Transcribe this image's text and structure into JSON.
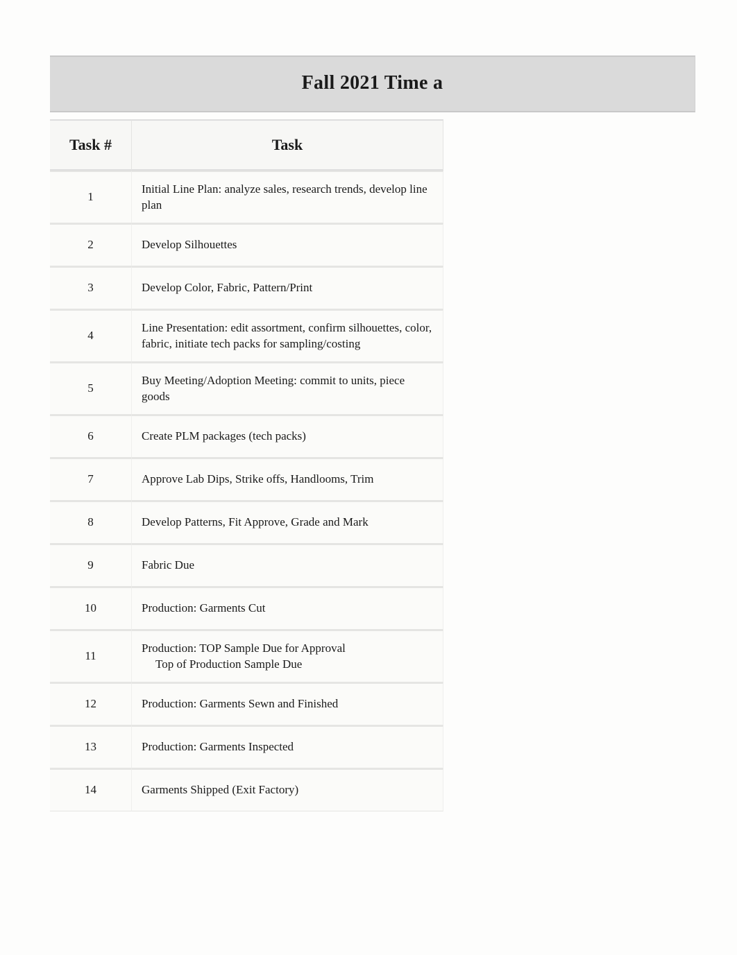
{
  "title": "Fall 2021 Time a",
  "headers": {
    "num": "Task #",
    "task": "Task"
  },
  "rows": [
    {
      "num": "1",
      "task": "Initial Line Plan: analyze sales, research trends, develop line plan",
      "lines": 2
    },
    {
      "num": "2",
      "task": "Develop Silhouettes",
      "lines": 1
    },
    {
      "num": "3",
      "task": "Develop Color, Fabric, Pattern/Print",
      "lines": 1
    },
    {
      "num": "4",
      "task": "Line Presentation: edit assortment, confirm silhouettes, color, fabric, initiate tech packs for sampling/costing",
      "lines": 2
    },
    {
      "num": "5",
      "task": "Buy Meeting/Adoption Meeting: commit to units, piece goods",
      "lines": 2
    },
    {
      "num": "6",
      "task": "Create PLM packages (tech packs)",
      "lines": 1
    },
    {
      "num": "7",
      "task": "Approve Lab Dips, Strike offs, Handlooms, Trim",
      "lines": 1
    },
    {
      "num": "8",
      "task": "Develop Patterns, Fit Approve, Grade and Mark",
      "lines": 1
    },
    {
      "num": "9",
      "task": "Fabric Due",
      "lines": 1
    },
    {
      "num": "10",
      "task": "Production: Garments Cut",
      "lines": 1
    },
    {
      "num": "11",
      "task": "Production: TOP Sample Due for Approval",
      "sub": "Top of Production Sample Due",
      "lines": 2
    },
    {
      "num": "12",
      "task": "Production: Garments Sewn and Finished",
      "lines": 1
    },
    {
      "num": "13",
      "task": "Production: Garments Inspected",
      "lines": 1
    },
    {
      "num": "14",
      "task": "Garments Shipped (Exit Factory)",
      "lines": 1
    }
  ]
}
